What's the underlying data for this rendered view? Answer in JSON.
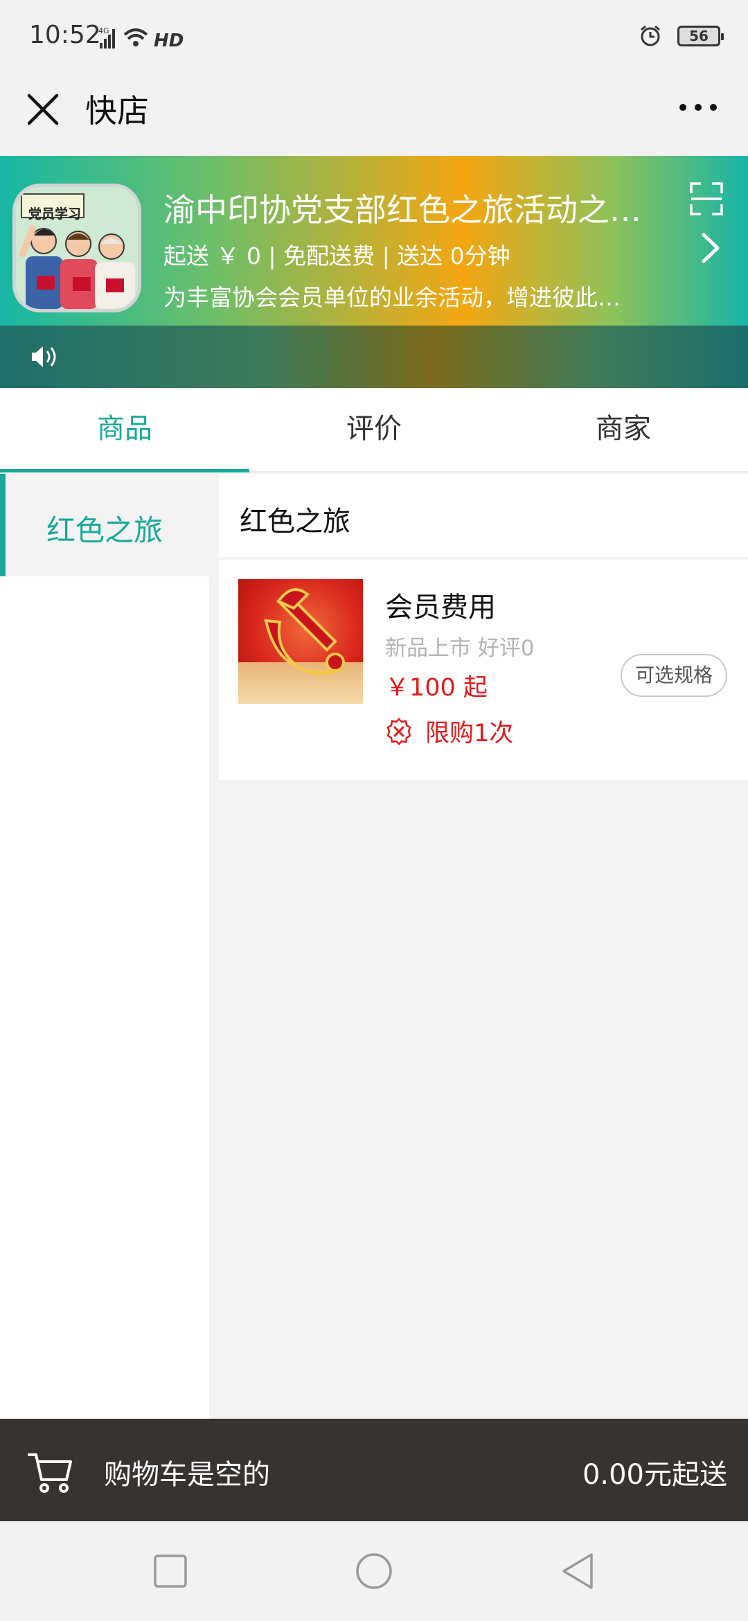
{
  "status_bar": {
    "time": "10:52",
    "network": "4G",
    "hd": "HD",
    "battery": "56"
  },
  "titlebar": {
    "title": "快店"
  },
  "shop": {
    "logo_text": "党员学习",
    "name": "渝中印协党支部红色之旅活动之…",
    "meta": "起送 ￥ 0 | 免配送费 | 送达 0分钟",
    "desc": "为丰富协会会员单位的业余活动，增进彼此…"
  },
  "tabs": [
    {
      "label": "商品",
      "active": true
    },
    {
      "label": "评价",
      "active": false
    },
    {
      "label": "商家",
      "active": false
    }
  ],
  "categories": [
    {
      "label": "红色之旅",
      "active": true
    }
  ],
  "section": {
    "title": "红色之旅"
  },
  "products": [
    {
      "name": "会员费用",
      "sub": "新品上市 好评0",
      "price": "￥100 起",
      "limit": "限购1次",
      "spec_button": "可选规格"
    }
  ],
  "cart": {
    "empty_text": "购物车是空的",
    "min_text": "0.00元起送"
  },
  "colors": {
    "accent": "#1aa99b",
    "price": "#e21a1a",
    "cart_bg": "#373331"
  }
}
